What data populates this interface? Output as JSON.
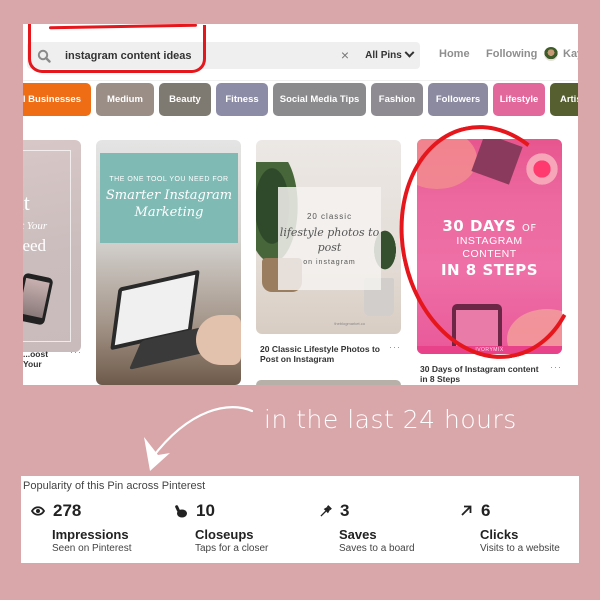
{
  "search": {
    "query": "instagram content ideas",
    "clear_icon": "×",
    "filter_label": "All Pins"
  },
  "nav": {
    "home": "Home",
    "following": "Following",
    "user": "Kay"
  },
  "categories": [
    {
      "label": "All Businesses",
      "color": "#ef6d15"
    },
    {
      "label": "Medium",
      "color": "#9b8e86"
    },
    {
      "label": "Beauty",
      "color": "#7f7a71"
    },
    {
      "label": "Fitness",
      "color": "#8d8ca6"
    },
    {
      "label": "Social Media Tips",
      "color": "#8b8b8e"
    },
    {
      "label": "Fashion",
      "color": "#8f8b92"
    },
    {
      "label": "Followers",
      "color": "#8b8aa0"
    },
    {
      "label": "Lifestyle",
      "color": "#e2679a"
    },
    {
      "label": "Artists",
      "color": "#555f2f"
    }
  ],
  "pins": [
    {
      "title": "...oost Your",
      "image_text": [
        "ent",
        "t Your",
        "Feed"
      ],
      "more": "···"
    },
    {
      "title": "",
      "image_text": [
        "THE ONE TOOL YOU NEED FOR",
        "Smarter Instagram Marketing"
      ],
      "more": ""
    },
    {
      "title": "20 Classic Lifestyle Photos to Post on Instagram",
      "image_text": [
        "20 classic",
        "lifestyle photos to post",
        "on instagram"
      ],
      "credit": "theblogmarket.co",
      "more": "···"
    },
    {
      "title": "30 Days of Instagram content in 8 Steps",
      "image_text": [
        "30 DAYS",
        "OF",
        "INSTAGRAM",
        "CONTENT",
        "IN 8 STEPS"
      ],
      "brand": "IVORYMIX",
      "more": "···"
    }
  ],
  "annotation": {
    "text": "in the last 24 hours",
    "highlight_color": "#e5161c"
  },
  "popularity": {
    "title": "Popularity of this Pin across Pinterest",
    "stats": [
      {
        "icon": "eye-icon",
        "value": "278",
        "label": "Impressions",
        "desc": "Seen on Pinterest"
      },
      {
        "icon": "hand-tap-icon",
        "value": "10",
        "label": "Closeups",
        "desc": "Taps for a closer"
      },
      {
        "icon": "pin-icon",
        "value": "3",
        "label": "Saves",
        "desc": "Saves to a board"
      },
      {
        "icon": "arrow-up-right-icon",
        "value": "6",
        "label": "Clicks",
        "desc": "Visits to a website"
      }
    ]
  }
}
